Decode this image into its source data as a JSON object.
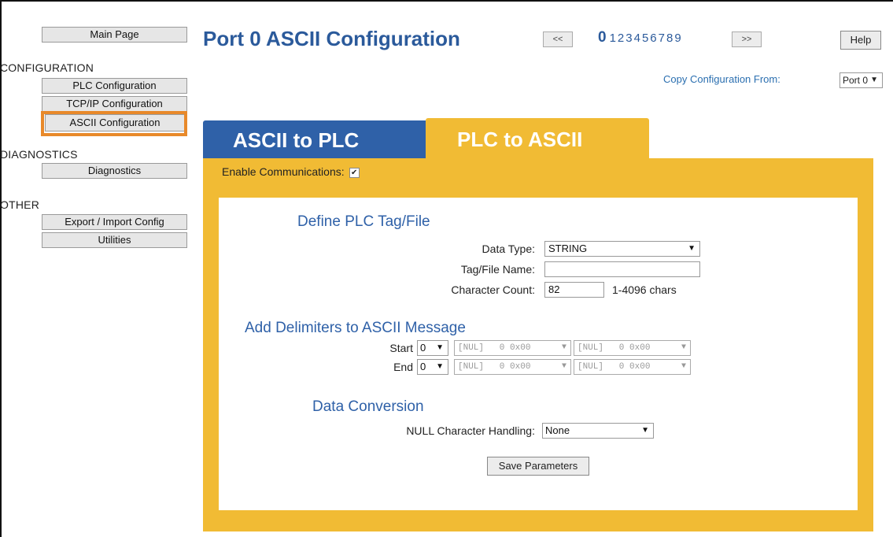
{
  "sidebar": {
    "main_page": "Main Page",
    "sections": [
      {
        "title": "CONFIGURATION",
        "items": [
          "PLC Configuration",
          "TCP/IP Configuration",
          "ASCII Configuration"
        ]
      },
      {
        "title": "DIAGNOSTICS",
        "items": [
          "Diagnostics"
        ]
      },
      {
        "title": "OTHER",
        "items": [
          "Export / Import Config",
          "Utilities"
        ]
      }
    ],
    "selected": "ASCII Configuration",
    "highlight_color": "#e8892a"
  },
  "header": {
    "title": "Port 0 ASCII Configuration",
    "prev_label": "<<",
    "next_label": ">>",
    "current_port": "0",
    "other_ports": "123456789",
    "help_label": "Help",
    "copy_label": "Copy Configuration From:",
    "copy_value": "Port 0"
  },
  "tabs": {
    "ascii_to_plc": "ASCII to PLC",
    "plc_to_ascii": "PLC to ASCII",
    "active": "PLC to ASCII",
    "blue": "#2f61a8",
    "gold": "#f1bb34"
  },
  "form": {
    "enable_label": "Enable Communications:",
    "enable_checked": true,
    "define_heading": "Define PLC Tag/File",
    "data_type_label": "Data Type:",
    "data_type_value": "STRING",
    "tag_name_label": "Tag/File Name:",
    "tag_name_value": "",
    "char_count_label": "Character Count:",
    "char_count_value": "82",
    "char_count_hint": "1-4096 chars",
    "delim_heading": "Add Delimiters to ASCII Message",
    "start_label": "Start",
    "start_count": "0",
    "start_delims": [
      "[NUL]   0 0x00",
      "[NUL]   0 0x00"
    ],
    "end_label": "End",
    "end_count": "0",
    "end_delims": [
      "[NUL]   0 0x00",
      "[NUL]   0 0x00"
    ],
    "conversion_heading": "Data Conversion",
    "null_label": "NULL Character Handling:",
    "null_value": "None",
    "save_label": "Save Parameters"
  }
}
